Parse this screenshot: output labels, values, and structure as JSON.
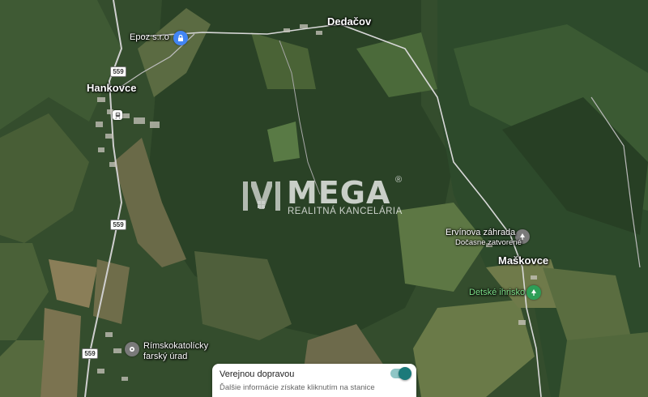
{
  "map": {
    "places": {
      "dedacov": "Dedačov",
      "hankovce": "Hankovce",
      "maskovce": "Maškovce"
    },
    "pois": {
      "epoz": "Epoz s.r.o",
      "ervinova_name": "Ervínova záhrada",
      "ervinova_status": "Dočasne zatvorené",
      "detske_ihrisko": "Detské ihrisko",
      "church_line1": "Rímskokatolícky",
      "church_line2": "farský úrad"
    },
    "road_shields": [
      "559",
      "559",
      "559"
    ],
    "watermark": {
      "brand": "MEGA",
      "sub": "REALITNÁ KANCELÁRIA",
      "registered": "®"
    },
    "icons": {
      "epoz": "lock-icon",
      "ervinova": "park-icon",
      "ihrisko": "park-icon",
      "church": "place-icon",
      "rail": "train-icon"
    },
    "colors": {
      "poi_blue": "#4285f4",
      "park_green": "#2e9e57",
      "place_gray": "#7a7a7a",
      "toggle_on": "#1b7a7a"
    }
  },
  "transit_card": {
    "title": "Verejnou dopravou",
    "description": "Ďalšie informácie získate kliknutím na stanice",
    "toggle_on": true
  }
}
